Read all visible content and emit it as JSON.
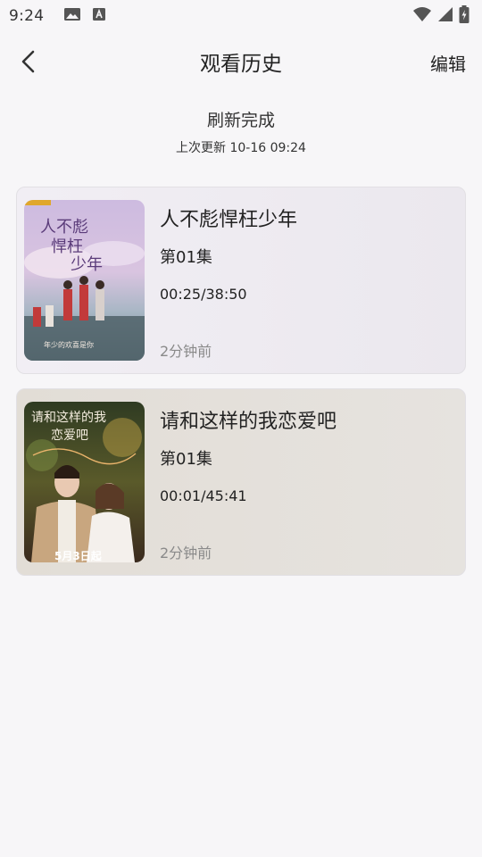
{
  "status_bar": {
    "time": "9:24",
    "icons": [
      "image-icon",
      "text-a-icon",
      "wifi-icon",
      "signal-icon",
      "battery-charging-icon"
    ]
  },
  "header": {
    "title": "观看历史",
    "edit_label": "编辑",
    "back_icon": "chevron-left-icon"
  },
  "refresh": {
    "state": "刷新完成",
    "updated": "上次更新 10-16 09:24"
  },
  "history": [
    {
      "title": "人不彪悍枉少年",
      "episode": "第01集",
      "progress": "00:25/38:50",
      "ago": "2分钟前",
      "poster_title": "人不彪悍枉少年",
      "poster_tagline": "年少的欢喜是你"
    },
    {
      "title": "请和这样的我恋爱吧",
      "episode": "第01集",
      "progress": "00:01/45:41",
      "ago": "2分钟前",
      "poster_title": "请和这样的我恋爱吧",
      "poster_date": "5月3日起"
    }
  ]
}
